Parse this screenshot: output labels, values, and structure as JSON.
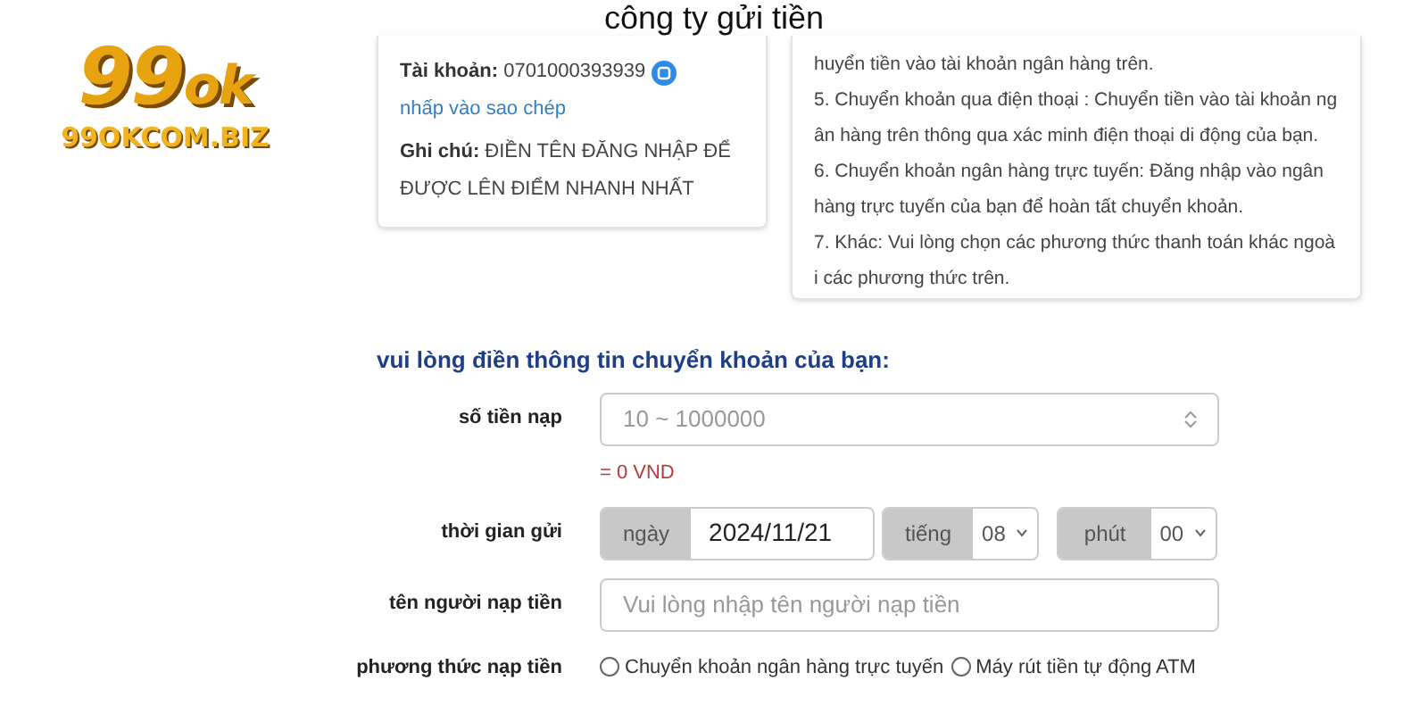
{
  "title": "công ty gửi tiền",
  "logo": {
    "mark": "99",
    "mark_suffix": "ok",
    "domain": "99OKCOM.BIZ"
  },
  "account_card": {
    "fields": [
      {
        "kind": "account",
        "label": "Tài khoản:",
        "value": "0701000393939",
        "link": "nhấp vào sao chép"
      },
      {
        "kind": "note",
        "label": "Ghi chú:",
        "value": "ĐIỀN TÊN ĐĂNG NHẬP ĐỂ ĐƯỢC LÊN ĐIỂM NHANH NHẤT"
      }
    ]
  },
  "methods_card": {
    "lines": [
      "huyển tiền vào tài khoản ngân hàng trên.",
      "5.   Chuyển khoản qua điện thoại : Chuyển tiền vào tài khoản ngân hàng trên thông qua xác minh điện thoại di động của bạn.",
      "6.   Chuyển khoản ngân hàng trực tuyến: Đăng nhập vào ngân hàng trực tuyến của bạn để hoàn tất chuyển khoản.",
      "7.   Khác: Vui lòng chọn các phương thức thanh toán khác ngoài các phương thức trên."
    ]
  },
  "form": {
    "heading": "vui lòng điền thông tin chuyển khoản của bạn:",
    "amount": {
      "label": "số tiền nạp",
      "placeholder": "10 ~ 1000000",
      "converted": "= 0 VND"
    },
    "time": {
      "label": "thời gian gửi",
      "date_label": "ngày",
      "date": "2024/11/21",
      "hour_label": "tiếng",
      "hour": "08",
      "minute_label": "phút",
      "minute": "00"
    },
    "depositor": {
      "label": "tên người nạp tiền",
      "placeholder": "Vui lòng nhập tên người nạp tiền"
    },
    "method": {
      "label": "phương thức nạp tiền",
      "options": [
        {
          "label": "Chuyển khoản ngân hàng trực tuyến",
          "selected": false
        },
        {
          "label": "Máy rút tiền tự động ATM",
          "selected": false
        }
      ]
    }
  }
}
